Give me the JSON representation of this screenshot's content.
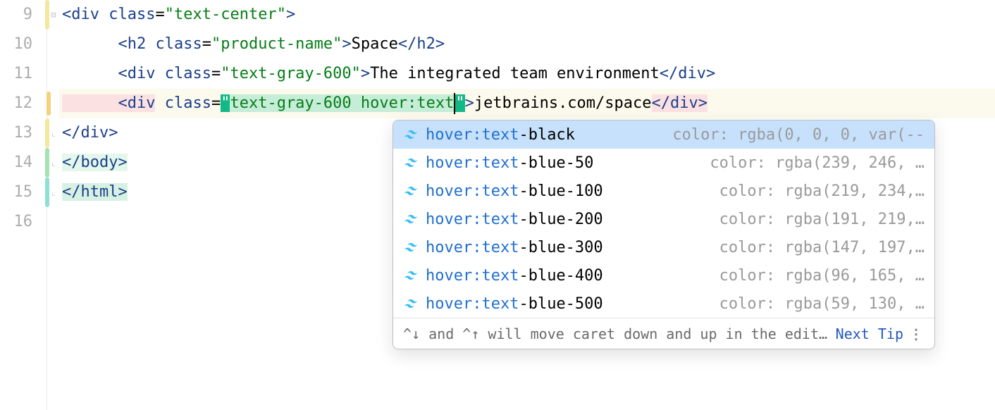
{
  "gutter": [
    "9",
    "10",
    "11",
    "12",
    "13",
    "14",
    "15",
    "16"
  ],
  "code": {
    "line9": {
      "indent0": "",
      "open": "<",
      "tag": "div",
      "sp": " ",
      "attr": "class",
      "eq": "=",
      "q1": "\"",
      "val": "text-center",
      "q2": "\"",
      "close": ">"
    },
    "line10": {
      "indent": "      ",
      "open": "<",
      "tag": "h2",
      "sp": " ",
      "attr": "class",
      "eq": "=",
      "q1": "\"",
      "val": "product-name",
      "q2": "\"",
      "close": ">",
      "text": "Space",
      "copen": "</",
      "ctag": "h2",
      "cclose": ">"
    },
    "line11": {
      "indent": "      ",
      "open": "<",
      "tag": "div",
      "sp": " ",
      "attr": "class",
      "eq": "=",
      "q1": "\"",
      "val": "text-gray-600",
      "q2": "\"",
      "close": ">",
      "text": "The integrated team environment",
      "copen": "</",
      "ctag": "div",
      "cclose": ">"
    },
    "line12": {
      "indent": "      ",
      "open": "<",
      "tag": "div",
      "sp": " ",
      "attr": "class",
      "eq": "=",
      "q1": "\"",
      "valA": "text-gray-600 ",
      "valB": "hover:text",
      "q2": "\"",
      "close": ">",
      "text": "jetbrains.com/space",
      "copen": "</",
      "ctag": "div",
      "cclose": ">"
    },
    "line13": {
      "open": "</",
      "tag": "div",
      "close": ">"
    },
    "line14": {
      "open": "</",
      "tag": "body",
      "close": ">"
    },
    "line15": {
      "open": "</",
      "tag": "html",
      "close": ">"
    }
  },
  "popup": {
    "items": [
      {
        "prefix": "hover:text",
        "suffix": "-black",
        "hint": "color: rgba(0, 0, 0, var(--"
      },
      {
        "prefix": "hover:text",
        "suffix": "-blue-50",
        "hint": "color: rgba(239, 246, …"
      },
      {
        "prefix": "hover:text",
        "suffix": "-blue-100",
        "hint": "color: rgba(219, 234,…"
      },
      {
        "prefix": "hover:text",
        "suffix": "-blue-200",
        "hint": "color: rgba(191, 219,…"
      },
      {
        "prefix": "hover:text",
        "suffix": "-blue-300",
        "hint": "color: rgba(147, 197,…"
      },
      {
        "prefix": "hover:text",
        "suffix": "-blue-400",
        "hint": "color: rgba(96, 165, …"
      },
      {
        "prefix": "hover:text",
        "suffix": "-blue-500",
        "hint": "color: rgba(59, 130, …"
      }
    ],
    "footer_tip": "^↓ and ^↑ will move caret down and up in the edit…",
    "footer_link": "Next Tip",
    "footer_more": "⋮"
  }
}
